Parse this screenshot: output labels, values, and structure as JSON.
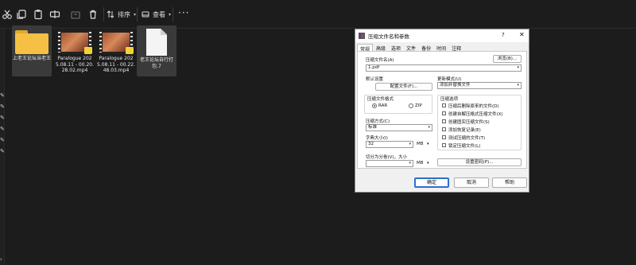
{
  "toolbar": {
    "sort_label": "排序",
    "view_label": "查看",
    "more_label": "···"
  },
  "files": [
    {
      "name": "上老王论坛当老王"
    },
    {
      "name": "Paralogue 2025.08.11 - 00.20.28.02.mp4"
    },
    {
      "name": "Paralogue 2025.08.11 - 00.22.48.03.mp4"
    },
    {
      "name": "老王论坛自行打包.7"
    }
  ],
  "dialog": {
    "title": "压缩文件名和参数",
    "help_glyph": "?",
    "close_glyph": "✕",
    "tabs": [
      "常规",
      "高级",
      "选项",
      "文件",
      "备份",
      "时间",
      "注释"
    ],
    "archive_name_label": "压缩文件名(A)",
    "browse_button": "浏览(B)...",
    "archive_name_value": "1.pdf",
    "default_settings_label": "默认设置",
    "profile_button": "配置文件(F)...",
    "update_mode_label": "更新模式(U)",
    "update_mode_value": "添加并替换文件",
    "format_group_label": "压缩文件格式",
    "format_rar": "RAR",
    "format_zip": "ZIP",
    "options_group_label": "压缩选项",
    "options": [
      "压缩后删除原来的文件(D)",
      "创建自解压格式压缩文件(X)",
      "创建固实压缩文件(S)",
      "添加恢复记录(E)",
      "测试压缩的文件(T)",
      "锁定压缩文件(L)"
    ],
    "method_label": "压缩方式(C)",
    "method_value": "标准",
    "dict_label": "字典大小(I)",
    "dict_value": "32",
    "dict_unit": "MB",
    "split_label": "切分为分卷(V)，大小",
    "split_unit": "MB",
    "password_button": "设置密码(P)...",
    "ok_button": "确定",
    "cancel_button": "取消",
    "help_button": "帮助"
  }
}
